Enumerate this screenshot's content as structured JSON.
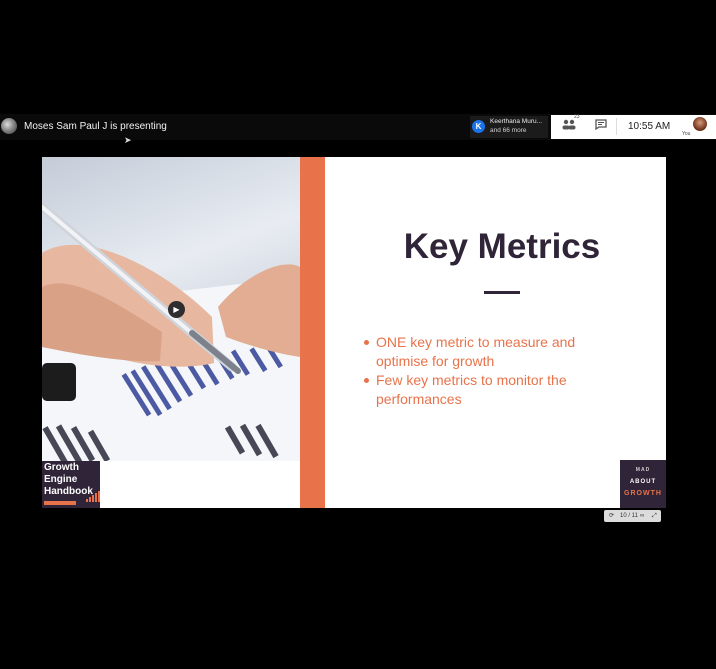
{
  "meeting": {
    "presenter_text": "Moses Sam Paul J is presenting",
    "participant_initial": "K",
    "participant_name": "Keerthana Muru...",
    "participant_more": "and 66 more",
    "participant_count": "23",
    "time": "10:55 AM",
    "self_label": "You"
  },
  "icons": {
    "people": "people-icon",
    "chat": "chat-icon",
    "play": "▶",
    "cursor": "➤"
  },
  "slide": {
    "title": "Key Metrics",
    "bullets": [
      "ONE key metric to measure and optimise for growth",
      "Few key metrics to monitor the performances"
    ],
    "logo_line1": "Growth",
    "logo_line2": "Engine",
    "logo_line3": "Handbook",
    "mad_line1": "MAD",
    "mad_line2": "ABOUT",
    "mad_line3": "GROWTH",
    "page_indicator": "10 / 11"
  },
  "colors": {
    "accent_orange": "#e8734a",
    "dark_purple": "#2f2438",
    "meet_blue": "#1a73e8"
  }
}
